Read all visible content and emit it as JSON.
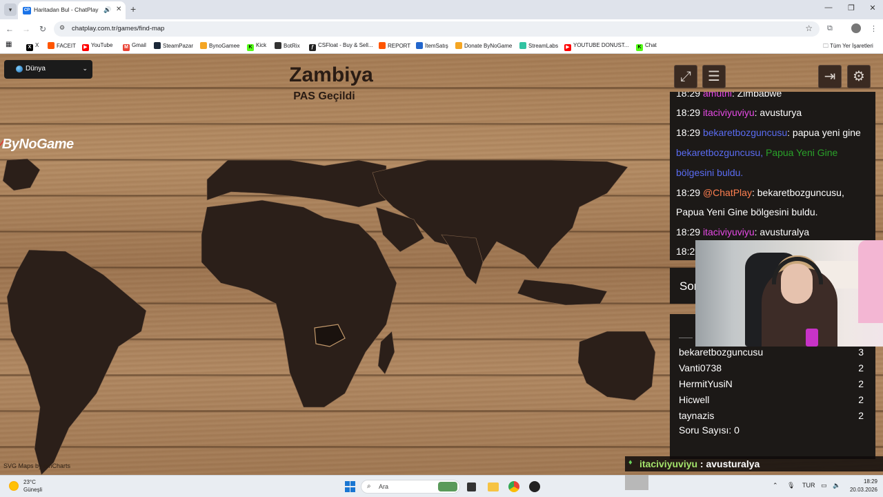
{
  "browser": {
    "tab_title": "Haritadan Bul - ChatPlay",
    "tab_favicon": "CP",
    "url": "chatplay.com.tr/games/find-map",
    "bookmarks": [
      {
        "label": "X",
        "icon": "x-icon",
        "color": "#000000"
      },
      {
        "label": "FACEIT",
        "icon": "faceit-icon",
        "color": "#ff5500"
      },
      {
        "label": "YouTube",
        "icon": "youtube-icon",
        "color": "#ff0000"
      },
      {
        "label": "Gmail",
        "icon": "gmail-icon",
        "color": "#ea4335"
      },
      {
        "label": "SteamPazar",
        "icon": "steam-icon",
        "color": "#1b2838"
      },
      {
        "label": "BynoGamee",
        "icon": "bynogame-icon",
        "color": "#f5a623"
      },
      {
        "label": "Kick",
        "icon": "kick-icon",
        "color": "#53fc18"
      },
      {
        "label": "BotRix",
        "icon": "botrix-icon",
        "color": "#333333"
      },
      {
        "label": "CSFloat - Buy & Sell...",
        "icon": "csfloat-icon",
        "color": "#222222"
      },
      {
        "label": "REPORT",
        "icon": "report-icon",
        "color": "#ff5500"
      },
      {
        "label": "İtemSatış",
        "icon": "itemsatis-icon",
        "color": "#2266cc"
      },
      {
        "label": "Donate ByNoGame",
        "icon": "bynogame-icon",
        "color": "#f5a623"
      },
      {
        "label": "StreamLabs",
        "icon": "streamlabs-icon",
        "color": "#31c3a2"
      },
      {
        "label": "YOUTUBE DONUST...",
        "icon": "youtube-icon",
        "color": "#ff0000"
      },
      {
        "label": "Chat",
        "icon": "kick-icon",
        "color": "#53fc18"
      }
    ],
    "all_bookmarks": "Tüm Yer İşaretleri"
  },
  "game": {
    "region": "Dünya",
    "country": "Zambiya",
    "status": "PAS Geçildi",
    "logo_mark": "⁄",
    "logo": "ByNoGame",
    "credit": "SVG Maps by amCharts"
  },
  "chat": {
    "lines": [
      {
        "time": "18:29",
        "user": "amuthi",
        "sep": ": ",
        "msg": "Zimbabwe"
      },
      {
        "time": "18:29",
        "user": "itaciviyuviyu",
        "sep": ": ",
        "msg": "avusturya"
      },
      {
        "time": "18:29",
        "user": "bekaretbozguncusu",
        "sep": ": ",
        "msg": "papua yeni gine"
      },
      {
        "time": "18:29",
        "user": "@ChatPlay",
        "sep": ": ",
        "msg": "bekaretbozguncusu,"
      },
      {
        "time": "18:29",
        "user": "itaciviyuviyu",
        "sep": ": ",
        "msg": "avusturalya"
      },
      {
        "time": "18:29"
      }
    ],
    "system_user": "bekaretbozguncusu,",
    "system_found": "Papua Yeni Gine",
    "system_tail": "bölgesini buldu.",
    "bot_cont": "Papua Yeni Gine bölgesini buldu."
  },
  "soru_partial": "Sor",
  "leaderboard": [
    {
      "name": "bekaretbozguncusu",
      "score": "3"
    },
    {
      "name": "Vanti0738",
      "score": "2"
    },
    {
      "name": "HermitYusiN",
      "score": "2"
    },
    {
      "name": "Hicwell",
      "score": "2"
    },
    {
      "name": "taynazis",
      "score": "2"
    }
  ],
  "soru_sayisi": "Soru Sayısı: 0",
  "bottom_message": {
    "user": "itaciviyuviyu",
    "text": " : avusturalya"
  },
  "taskbar": {
    "temp": "23°C",
    "condition": "Güneşli",
    "search_placeholder": "Ara",
    "lang": "TUR",
    "time": "18:29",
    "date": "20.03.2026"
  }
}
